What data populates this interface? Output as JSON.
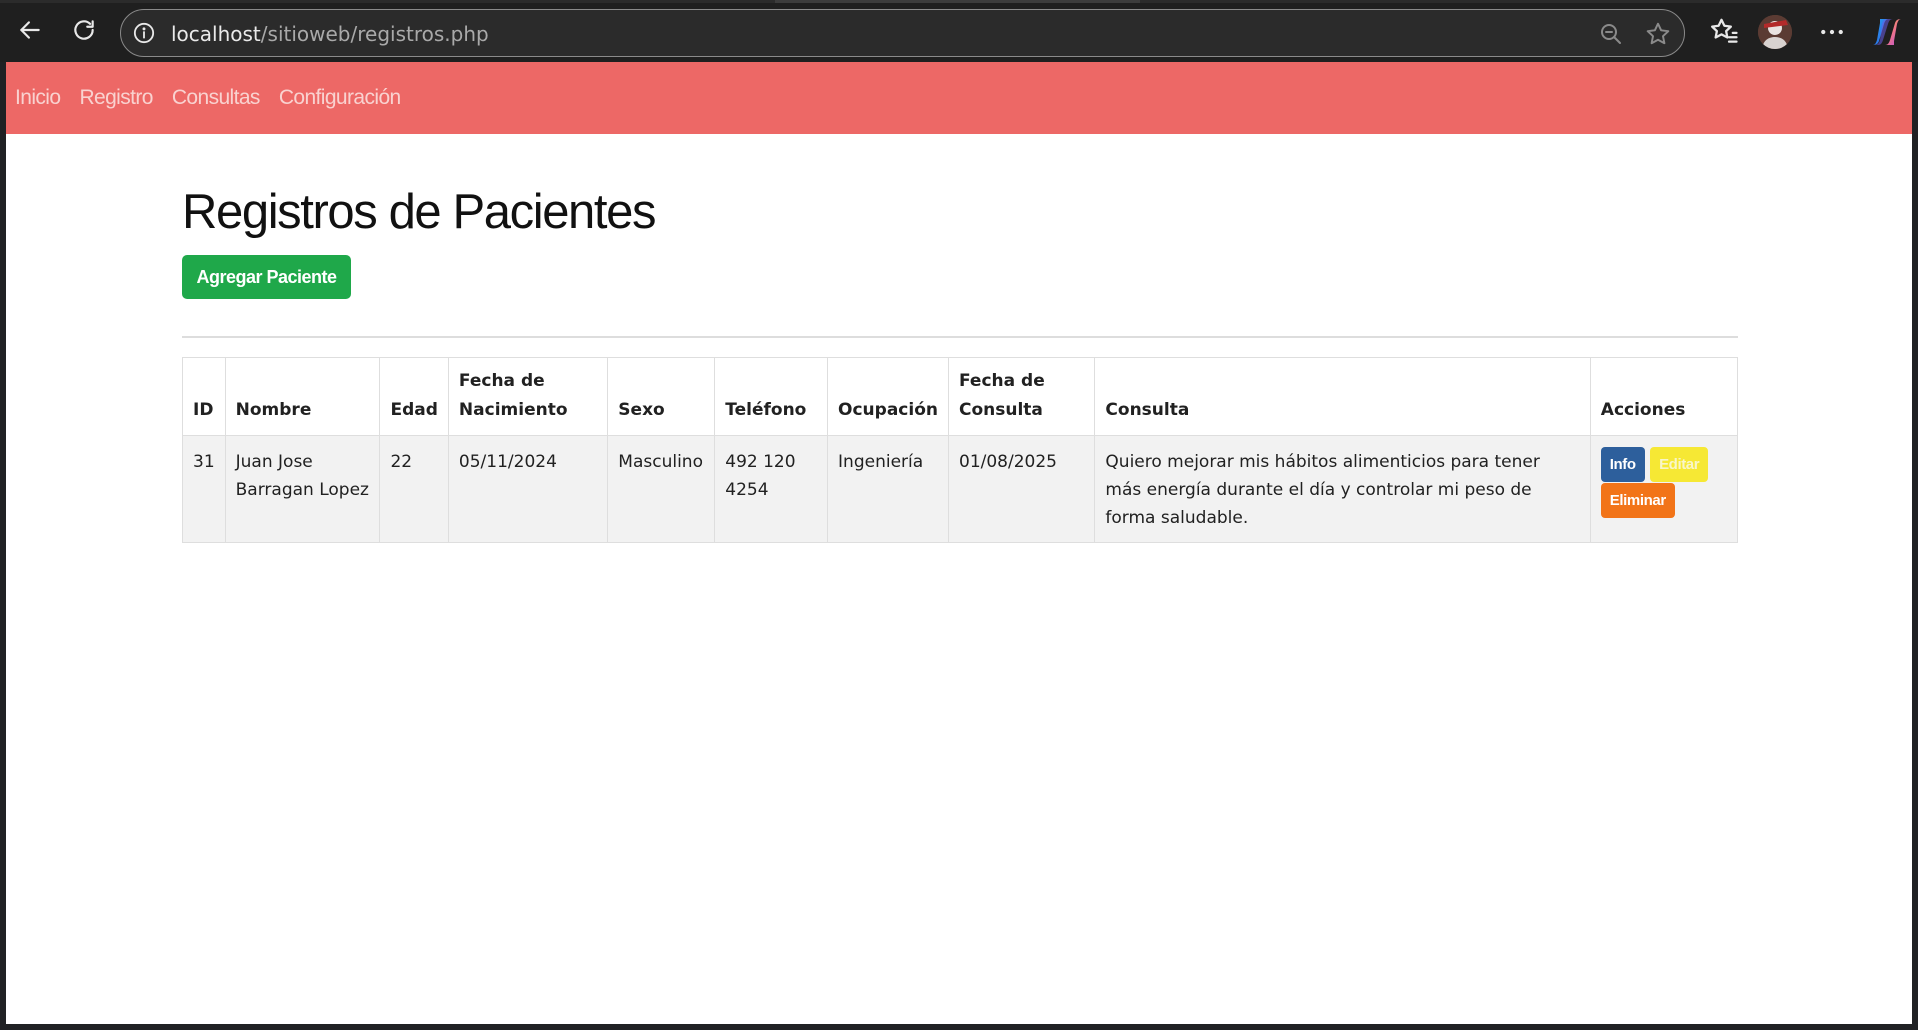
{
  "browser": {
    "url_host": "localhost",
    "url_path": "/sitioweb/registros.php"
  },
  "navbar": {
    "items": [
      {
        "label": "Inicio"
      },
      {
        "label": "Registro"
      },
      {
        "label": "Consultas"
      },
      {
        "label": "Configuración"
      }
    ]
  },
  "page": {
    "title": "Registros de Pacientes",
    "add_button": "Agregar Paciente"
  },
  "table": {
    "headers": {
      "id": "ID",
      "nombre": "Nombre",
      "edad": "Edad",
      "fecha_nacimiento": "Fecha de Nacimiento",
      "sexo": "Sexo",
      "telefono": "Teléfono",
      "ocupacion": "Ocupación",
      "fecha_consulta": "Fecha de Consulta",
      "consulta": "Consulta",
      "acciones": "Acciones"
    },
    "rows": [
      {
        "id": "31",
        "nombre": "Juan Jose Barragan Lopez",
        "edad": "22",
        "fecha_nacimiento": "05/11/2024",
        "sexo": "Masculino",
        "telefono": "492 120 4254",
        "ocupacion": "Ingeniería",
        "fecha_consulta": "01/08/2025",
        "consulta": "Quiero mejorar mis hábitos alimenticios para tener más energía durante el día y controlar mi peso de forma saludable.",
        "actions": {
          "info": "Info",
          "edit": "Editar",
          "delete": "Eliminar"
        }
      }
    ]
  },
  "colors": {
    "navbar": "#ed6866",
    "add_button": "#1fa84a",
    "info_button": "#2d5f9c",
    "edit_button": "#f6e834",
    "delete_button": "#f27418"
  }
}
